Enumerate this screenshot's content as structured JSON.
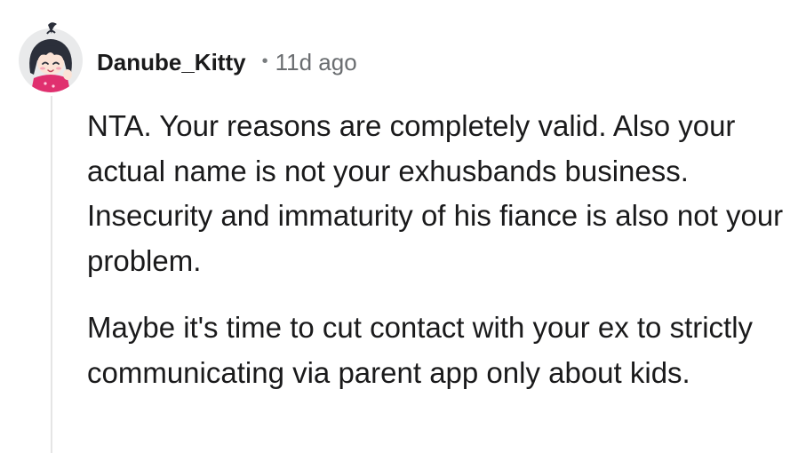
{
  "comment": {
    "author": "Danube_Kitty",
    "separator": "•",
    "timestamp": "11d ago",
    "avatar_icon": "anime-girl-avatar-icon",
    "paragraphs": [
      "NTA. Your reasons are completely valid. Also your actual name is not your exhusbands business. Insecurity and immaturity of his fiance is also not your problem.",
      "Maybe it's time to cut contact with your ex to strictly communicating via parent app only about kids."
    ]
  },
  "colors": {
    "text": "#1a1a1b",
    "meta": "#6a6d70",
    "thread_line": "#e5e5e5",
    "avatar_bg": "#e9eaeb",
    "avatar_shirt": "#e0306f"
  }
}
